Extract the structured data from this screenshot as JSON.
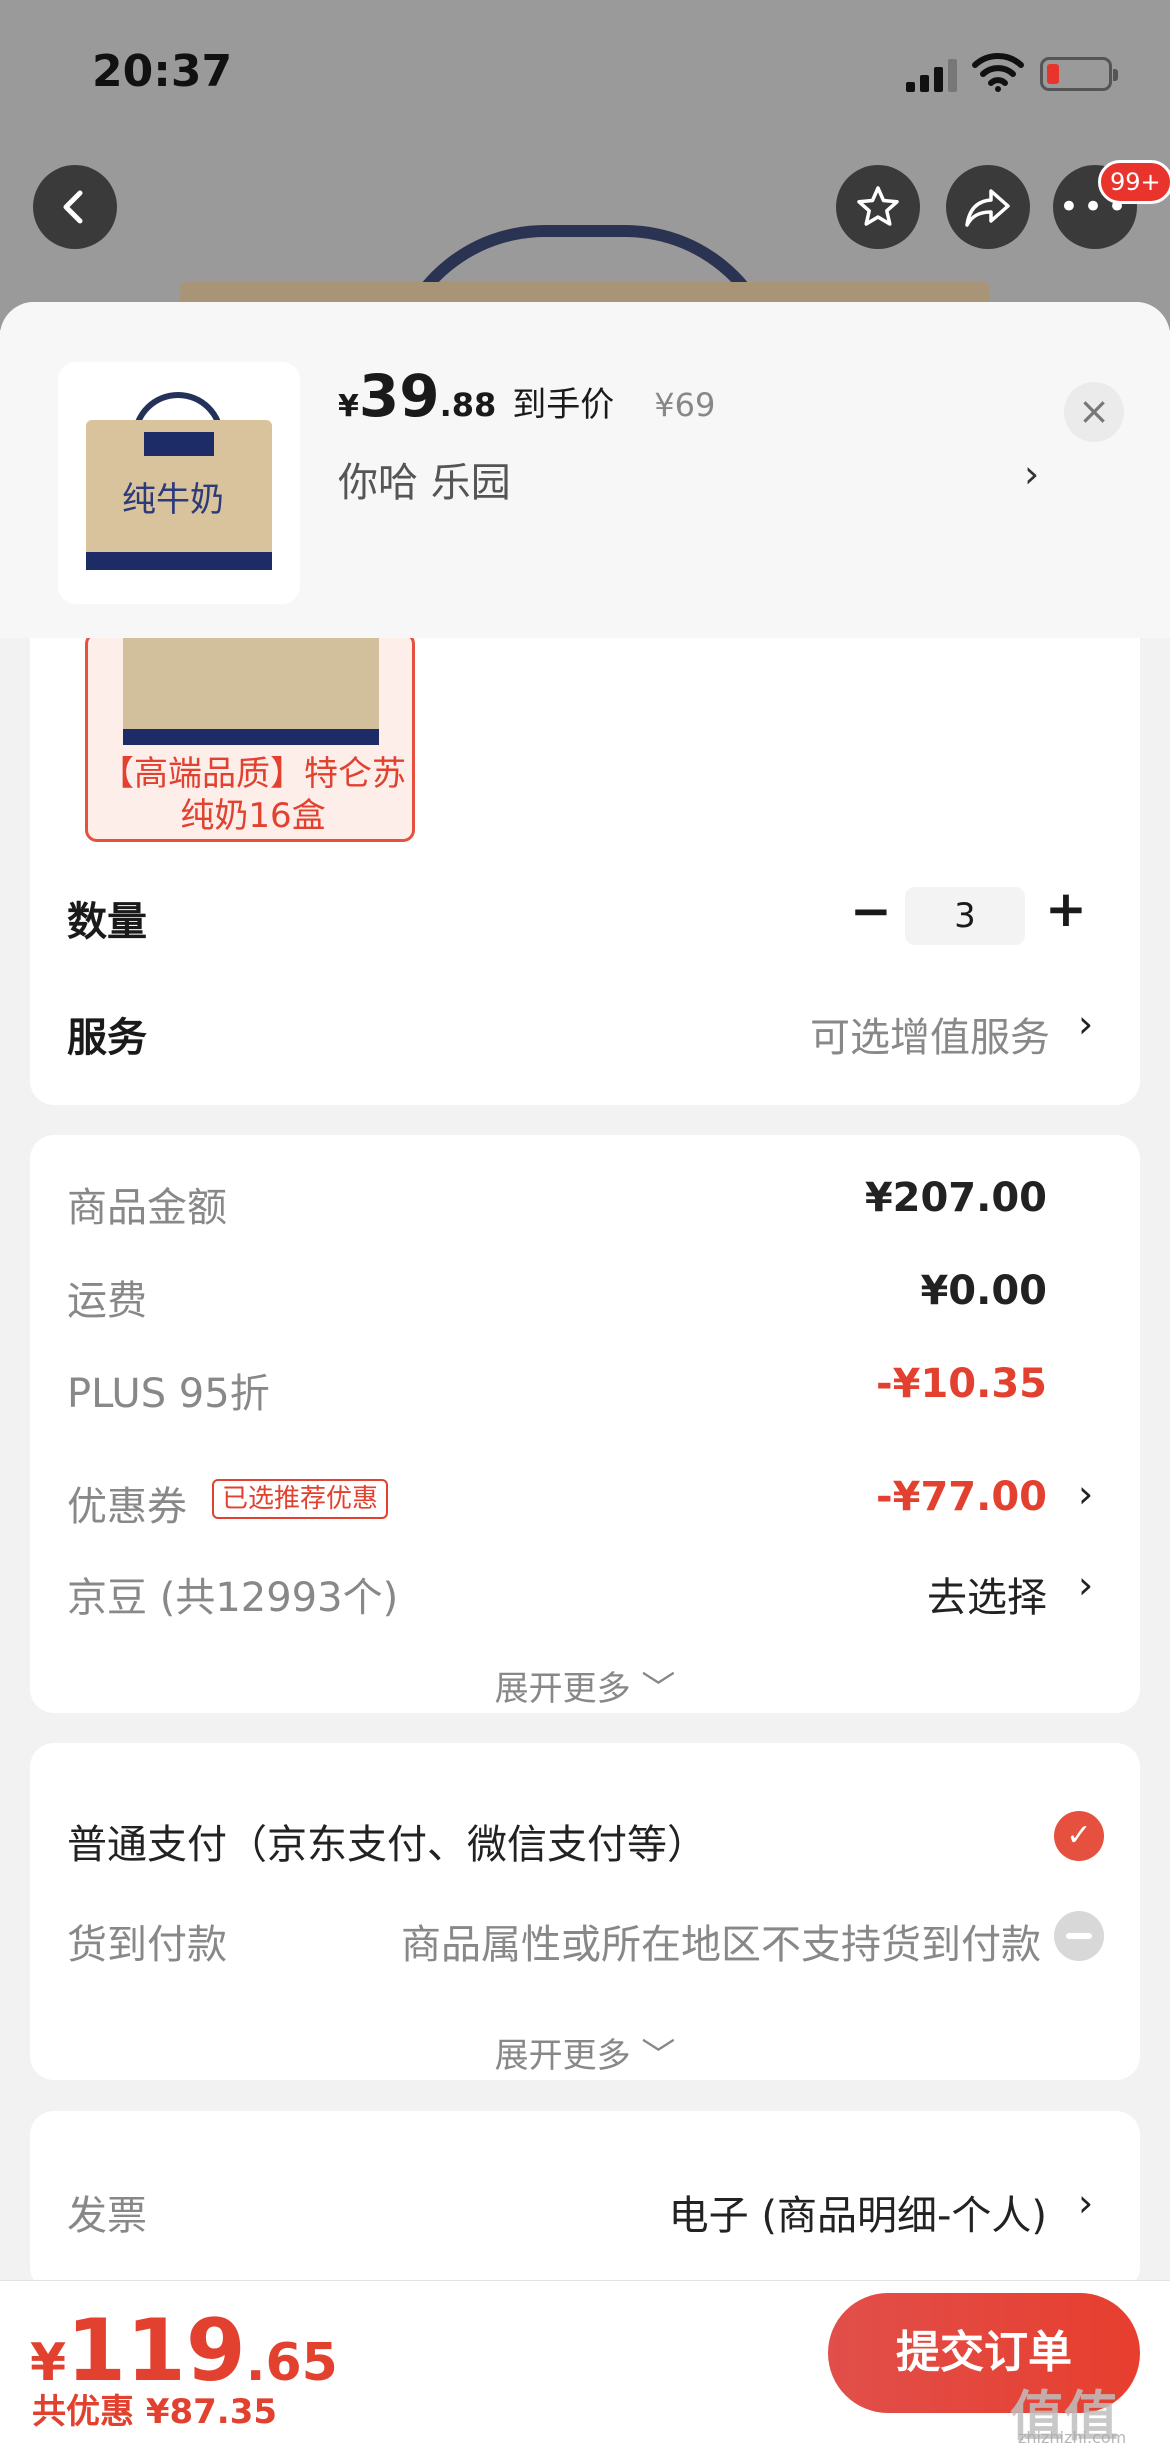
{
  "status_bar": {
    "time": "20:37"
  },
  "top_bar": {
    "more_badge": "99+"
  },
  "product_header": {
    "currency": "¥",
    "price_int": "39",
    "price_dec": ".88",
    "price_label": "到手价",
    "original_price": "¥69",
    "spec_text": "你哈  乐园",
    "close_icon": "×",
    "box_name": "纯牛奶"
  },
  "variant": {
    "label": "【高端品质】特仑苏纯奶16盒"
  },
  "quantity": {
    "label": "数量",
    "minus": "−",
    "value": "3",
    "plus": "+"
  },
  "service": {
    "label": "服务",
    "value": "可选增值服务"
  },
  "fees": [
    {
      "label": "商品金额",
      "value": "¥207.00"
    },
    {
      "label": "运费",
      "value": "¥0.00"
    },
    {
      "label": "PLUS 95折",
      "value": "-¥10.35"
    },
    {
      "label": "优惠券",
      "tag": "已选推荐优惠",
      "value": "-¥77.00"
    },
    {
      "label": "京豆 (共12993个)",
      "value": "去选择"
    }
  ],
  "expand_more": "展开更多 ﹀",
  "payment": {
    "options": [
      {
        "label": "普通支付（京东支付、微信支付等）",
        "note": ""
      },
      {
        "label": "货到付款",
        "note": "商品属性或所在地区不支持货到付款"
      }
    ],
    "check_icon": "✓"
  },
  "invoice": {
    "label": "发票",
    "value": "电子 (商品明细-个人)"
  },
  "chevron": "›",
  "bottom": {
    "currency": "¥",
    "total_int": "119",
    "total_dec": ".65",
    "discount": "共优惠 ¥87.35",
    "submit": "提交订单"
  },
  "watermark": {
    "main": "值值值",
    "sub": "zhizhizhi.com"
  },
  "colors": {
    "accent_red": "#e2412f",
    "dim_bg": "#9a9a9a"
  }
}
